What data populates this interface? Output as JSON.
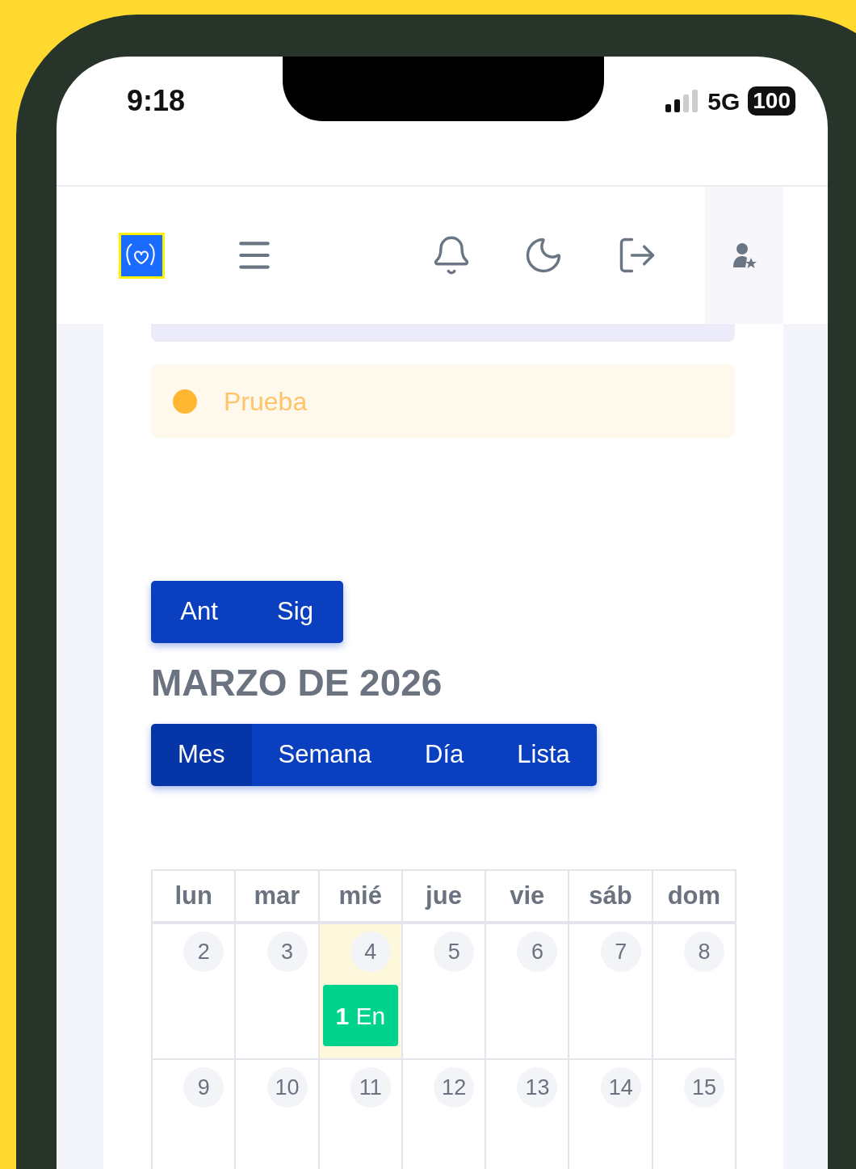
{
  "status_bar": {
    "time": "9:18",
    "network": "5G",
    "battery": "100"
  },
  "alert": {
    "label": "Prueba"
  },
  "nav_buttons": [
    {
      "label": "Ant"
    },
    {
      "label": "Sig"
    }
  ],
  "title": "MARZO DE 2026",
  "view_tabs": [
    {
      "label": "Mes",
      "selected": true
    },
    {
      "label": "Semana",
      "selected": false
    },
    {
      "label": "Día",
      "selected": false
    },
    {
      "label": "Lista",
      "selected": false
    }
  ],
  "calendar": {
    "weekdays": [
      "lun",
      "mar",
      "mié",
      "jue",
      "vie",
      "sáb",
      "dom"
    ],
    "weeks": [
      [
        {
          "day": "2",
          "today": false
        },
        {
          "day": "3",
          "today": false
        },
        {
          "day": "4",
          "today": true,
          "events": [
            "**1** En"
          ]
        },
        {
          "day": "5",
          "today": false
        },
        {
          "day": "6",
          "today": false
        },
        {
          "day": "7",
          "today": false
        },
        {
          "day": "8",
          "today": false
        }
      ],
      [
        {
          "day": "9",
          "today": false
        },
        {
          "day": "10",
          "today": false
        },
        {
          "day": "11",
          "today": false
        },
        {
          "day": "12",
          "today": false
        },
        {
          "day": "13",
          "today": false
        },
        {
          "day": "14",
          "today": false
        },
        {
          "day": "15",
          "today": false
        }
      ]
    ]
  }
}
